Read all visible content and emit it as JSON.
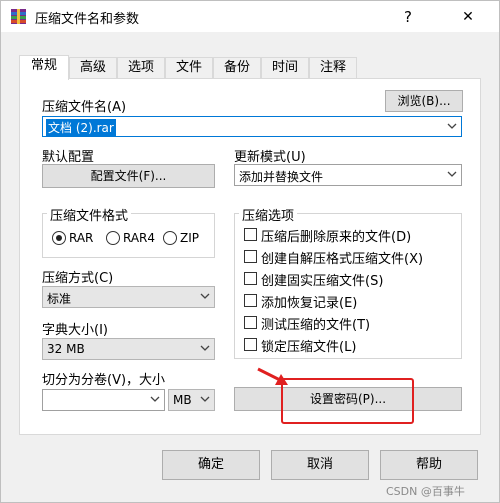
{
  "window": {
    "title": "压缩文件名和参数",
    "help_glyph": "?",
    "close_glyph": "✕"
  },
  "tabs": [
    {
      "label": "常规",
      "active": true
    },
    {
      "label": "高级",
      "active": false
    },
    {
      "label": "选项",
      "active": false
    },
    {
      "label": "文件",
      "active": false
    },
    {
      "label": "备份",
      "active": false
    },
    {
      "label": "时间",
      "active": false
    },
    {
      "label": "注释",
      "active": false
    }
  ],
  "archive": {
    "name_label": "压缩文件名(A)",
    "name_value": "文档 (2).rar",
    "browse_label": "浏览(B)..."
  },
  "profile": {
    "label": "默认配置",
    "button_label": "配置文件(F)..."
  },
  "update_mode": {
    "label": "更新模式(U)",
    "value": "添加并替换文件"
  },
  "format": {
    "title": "压缩文件格式",
    "options": [
      {
        "label": "RAR",
        "selected": true
      },
      {
        "label": "RAR4",
        "selected": false
      },
      {
        "label": "ZIP",
        "selected": false
      }
    ]
  },
  "compression_options": {
    "title": "压缩选项",
    "items": [
      {
        "label": "压缩后删除原来的文件(D)",
        "checked": false
      },
      {
        "label": "创建自解压格式压缩文件(X)",
        "checked": false
      },
      {
        "label": "创建固实压缩文件(S)",
        "checked": false
      },
      {
        "label": "添加恢复记录(E)",
        "checked": false
      },
      {
        "label": "测试压缩的文件(T)",
        "checked": false
      },
      {
        "label": "锁定压缩文件(L)",
        "checked": false
      }
    ]
  },
  "method": {
    "label": "压缩方式(C)",
    "value": "标准"
  },
  "dictionary": {
    "label": "字典大小(I)",
    "value": "32 MB"
  },
  "split": {
    "label": "切分为分卷(V)，大小",
    "value": "",
    "unit": "MB"
  },
  "password_button": "设置密码(P)...",
  "footer": {
    "ok": "确定",
    "cancel": "取消",
    "help": "帮助"
  },
  "watermark": "CSDN @百事牛",
  "colors": {
    "accent": "#0078d7",
    "highlight": "#e02020"
  }
}
